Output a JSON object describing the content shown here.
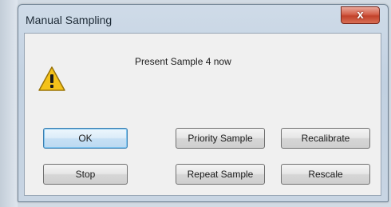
{
  "window": {
    "title": "Manual Sampling",
    "close_glyph": "x"
  },
  "dialog": {
    "message": "Present Sample 4 now",
    "icon": "warning-icon",
    "buttons": {
      "ok": "OK",
      "priority_sample": "Priority Sample",
      "recalibrate": "Recalibrate",
      "stop": "Stop",
      "repeat_sample": "Repeat Sample",
      "rescale": "Rescale"
    }
  },
  "colors": {
    "close_button": "#c2412a",
    "warning_fill": "#f4c21a",
    "default_button_border": "#3c7fb1"
  }
}
